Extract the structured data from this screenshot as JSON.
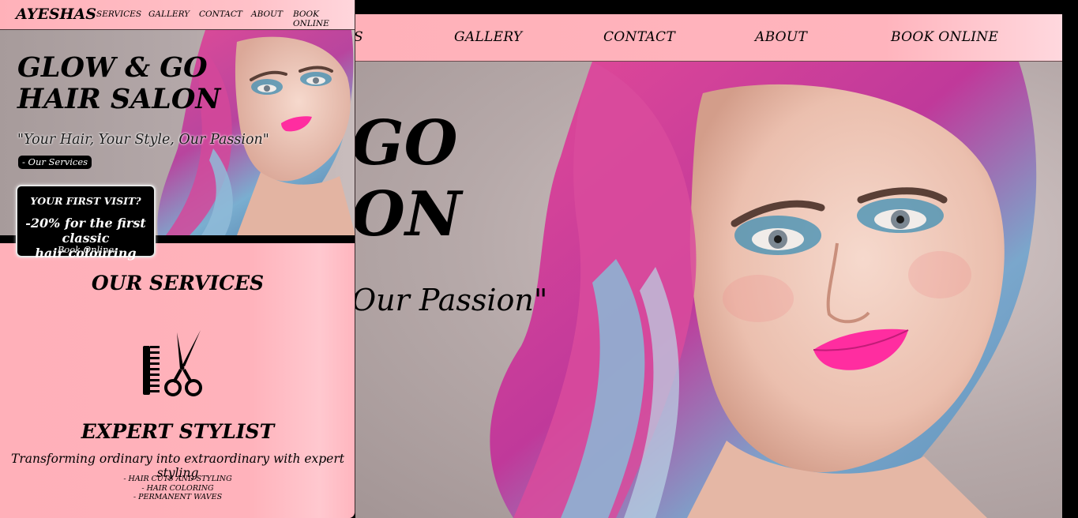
{
  "desktop": {
    "nav": {
      "items": [
        "S",
        "GALLERY",
        "CONTACT",
        "ABOUT",
        "BOOK ONLINE"
      ]
    },
    "hero": {
      "title_line1": "GO",
      "title_line2": "ON",
      "tagline": "Our Passion\""
    }
  },
  "mobile": {
    "nav": {
      "logo": "AYESHAS",
      "items": [
        "SERVICES",
        "GALLERY",
        "CONTACT",
        "ABOUT",
        "BOOK ONLINE"
      ]
    },
    "hero": {
      "title_line1": "GLOW & GO",
      "title_line2": "HAIR SALON",
      "tagline": "\"Your Hair, Your Style, Our Passion\"",
      "services_button": "- Our Services"
    },
    "promo": {
      "question": "YOUR FIRST VISIT?",
      "offer_line1": "-20% for the first classic",
      "offer_line2": "hair colouring",
      "book": "Book Online"
    },
    "services": {
      "heading": "OUR SERVICES",
      "icon": "comb-and-scissors-icon",
      "stylist_title": "EXPERT STYLIST",
      "stylist_desc": "Transforming ordinary into extraordinary with expert styling",
      "list": [
        "- HAIR CUTS AND STYLING",
        "- HAIR COLORING",
        "- PERMANENT WAVES"
      ]
    }
  },
  "colors": {
    "nav_pink": "#ffb1b9",
    "nav_pink_light": "#ffd8de",
    "body_pink": "#ffb0b9",
    "promo_bg": "#000000",
    "hair_pink": "#e0408f",
    "hair_blue": "#6fa6c8",
    "lips": "#ff2da0"
  }
}
